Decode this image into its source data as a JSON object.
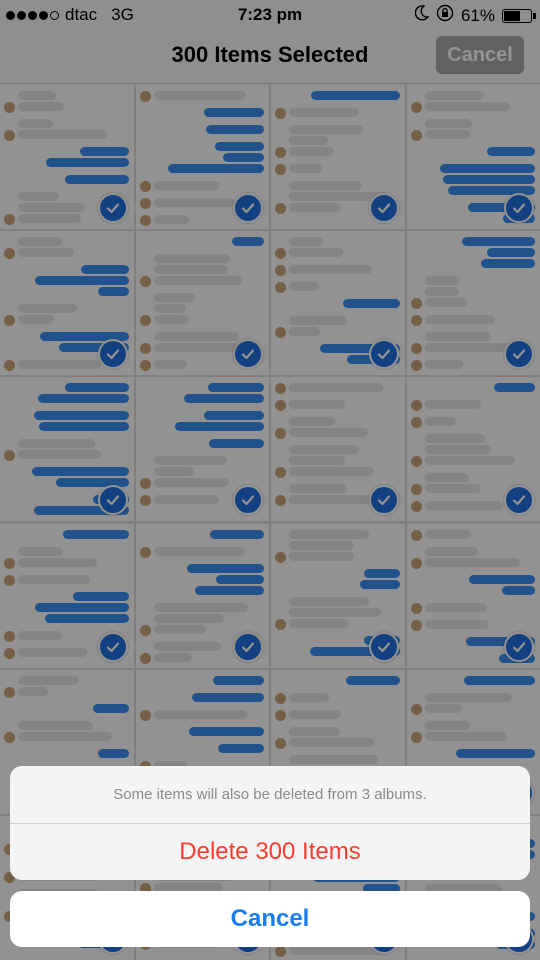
{
  "status_bar": {
    "carrier": "dtac",
    "network": "3G",
    "time": "7:23 pm",
    "battery_percent": "61%",
    "battery_level": 0.61,
    "signal_bars_filled": 4,
    "signal_bars_total": 5
  },
  "nav": {
    "title": "300 Items Selected",
    "cancel_label": "Cancel"
  },
  "grid": {
    "columns": 4,
    "rows": 6,
    "selected_count": 300
  },
  "action_sheet": {
    "message": "Some items will also be deleted from 3 albums.",
    "delete_label": "Delete 300 Items",
    "cancel_label": "Cancel"
  },
  "colors": {
    "accent": "#1a7cf5",
    "destructive": "#ff3b30",
    "check_fill": "#1f6fdc",
    "out_bubble": "#3b8ef0"
  }
}
